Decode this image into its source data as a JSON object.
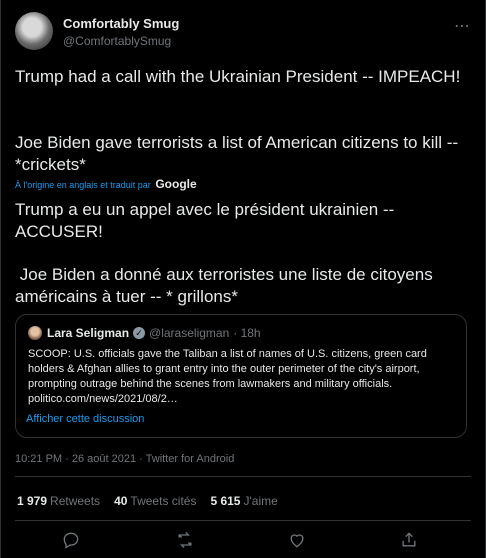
{
  "author": {
    "display_name": "Comfortably Smug",
    "handle": "@ComfortablySmug"
  },
  "tweet": {
    "line1": "Trump had a call with the Ukrainian President -- IMPEACH!",
    "line2": "Joe Biden gave terrorists a list of American citizens to kill -- *crickets*",
    "translation_note": "À l'origine en anglais et traduit par",
    "translation_provider": "Google",
    "translated1": "Trump a eu un appel avec le président ukrainien -- ACCUSER!",
    "translated2": " Joe Biden a donné aux terroristes une liste de citoyens américains à tuer -- * grillons*"
  },
  "quote": {
    "display_name": "Lara Seligman",
    "handle": "@laraseligman",
    "time": "· 18h",
    "text": "SCOOP: U.S. officials gave the Taliban a list of names of U.S. citizens, green card holders & Afghan allies to grant entry into the outer perimeter of the city's airport, prompting outrage behind the scenes from lawmakers and military officials. politico.com/news/2021/08/2…",
    "show_thread": "Afficher cette discussion"
  },
  "meta": {
    "timestamp": "10:21 PM · 26 août 2021 · Twitter for Android"
  },
  "stats": {
    "retweets_count": "1 979",
    "retweets_label": "Retweets",
    "quotes_count": "40",
    "quotes_label": "Tweets cités",
    "likes_count": "5 615",
    "likes_label": "J'aime"
  },
  "icons": {
    "more": "more-icon",
    "reply": "reply-icon",
    "retweet": "retweet-icon",
    "like": "like-icon",
    "share": "share-icon",
    "verified": "verified-icon"
  },
  "colors": {
    "background": "#000000",
    "text": "#e7e9ea",
    "muted": "#71767b",
    "link": "#1d9bf0",
    "border": "#2f3336"
  }
}
